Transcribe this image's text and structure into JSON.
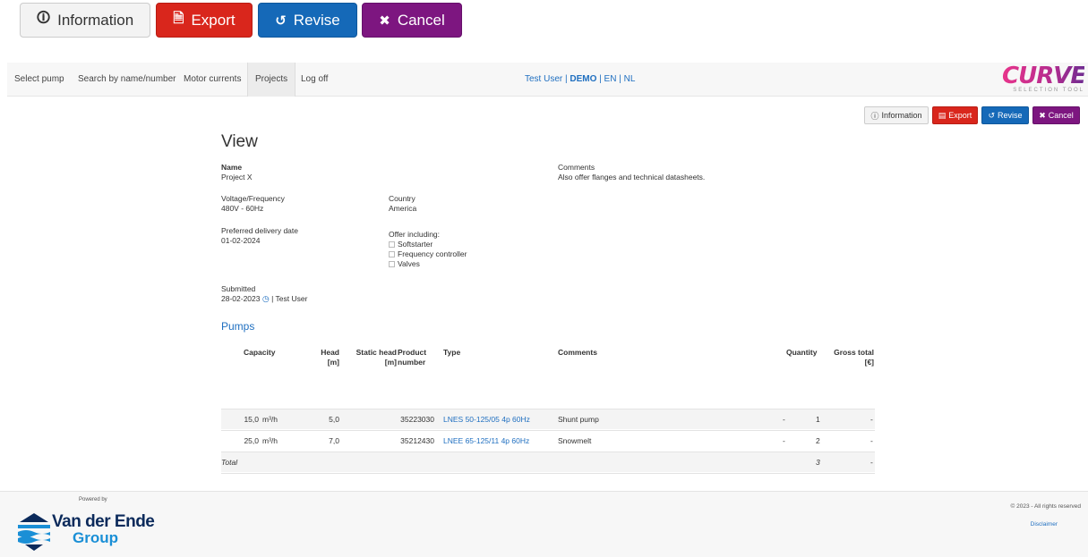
{
  "top_toolbar": {
    "information": "Information",
    "export": "Export",
    "revise": "Revise",
    "cancel": "Cancel"
  },
  "nav": {
    "items": [
      "Select pump",
      "Search by name/number",
      "Motor currents",
      "Projects",
      "Log off"
    ],
    "active": "Projects",
    "user": "Test User",
    "demo": "DEMO",
    "lang_en": "EN",
    "lang_nl": "NL",
    "logo_word": "CURVES",
    "logo_sub": "SELECTION TOOL"
  },
  "small_toolbar": {
    "information": "Information",
    "export": "Export",
    "revise": "Revise",
    "cancel": "Cancel"
  },
  "view": {
    "title": "View",
    "name_label": "Name",
    "name_value": "Project X",
    "comments_label": "Comments",
    "comments_value": "Also offer flanges and technical datasheets.",
    "voltage_label": "Voltage/Frequency",
    "voltage_value": "480V - 60Hz",
    "country_label": "Country",
    "country_value": "America",
    "delivery_label": "Preferred delivery date",
    "delivery_value": "01-02-2024",
    "offer_label": "Offer including:",
    "offer_options": [
      "Softstarter",
      "Frequency controller",
      "Valves"
    ],
    "submitted_label": "Submitted",
    "submitted_date": "28-02-2023",
    "submitted_user": "| Test User"
  },
  "pumps": {
    "title": "Pumps",
    "headers": {
      "capacity": "Capacity",
      "head_1": "Head",
      "head_2": "[m]",
      "static_1": "Static head",
      "static_2": "[m]",
      "product_1": "Product",
      "product_2": "number",
      "type": "Type",
      "comments": "Comments",
      "quantity": "Quantity",
      "gross_1": "Gross total",
      "gross_2": "[€]"
    },
    "rows": [
      {
        "capacity": "15,0",
        "unit": "m³/h",
        "head": "5,0",
        "product": "35223030",
        "type": "LNES 50-125/05 4p 60Hz",
        "comments": "Shunt pump",
        "dash": "-",
        "quantity": "1",
        "gross": "-"
      },
      {
        "capacity": "25,0",
        "unit": "m³/h",
        "head": "7,0",
        "product": "35212430",
        "type": "LNEE 65-125/11 4p 60Hz",
        "comments": "Snowmelt",
        "dash": "-",
        "quantity": "2",
        "gross": "-"
      }
    ],
    "total_label": "Total",
    "total_quantity": "3",
    "total_gross": "-"
  },
  "footer": {
    "powered_by": "Powered by",
    "brand": "Van der Ende",
    "brand_group": "Group",
    "copyright": "© 2023 - All rights reserved",
    "disclaimer": "Disclaimer"
  }
}
